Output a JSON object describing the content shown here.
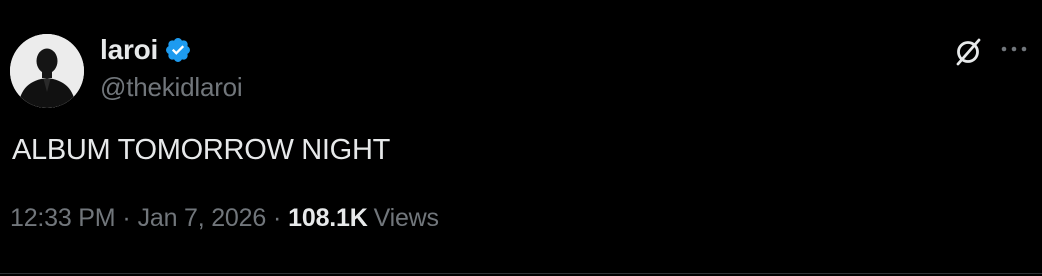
{
  "author": {
    "display_name": "laroi",
    "handle": "@thekidlaroi",
    "verified": true
  },
  "tweet": {
    "text": "ALBUM TOMORROW NIGHT",
    "time": "12:33 PM",
    "separator": "·",
    "date": "Jan 7, 2026",
    "views_count": "108.1K",
    "views_label": "Views"
  },
  "icons": {
    "verified": "verified-badge-icon",
    "grok": "grok-icon",
    "more": "more-options-icon"
  },
  "colors": {
    "background": "#000000",
    "primary_text": "#e7e9ea",
    "secondary_text": "#71767b",
    "verified_blue": "#1d9bf0"
  }
}
